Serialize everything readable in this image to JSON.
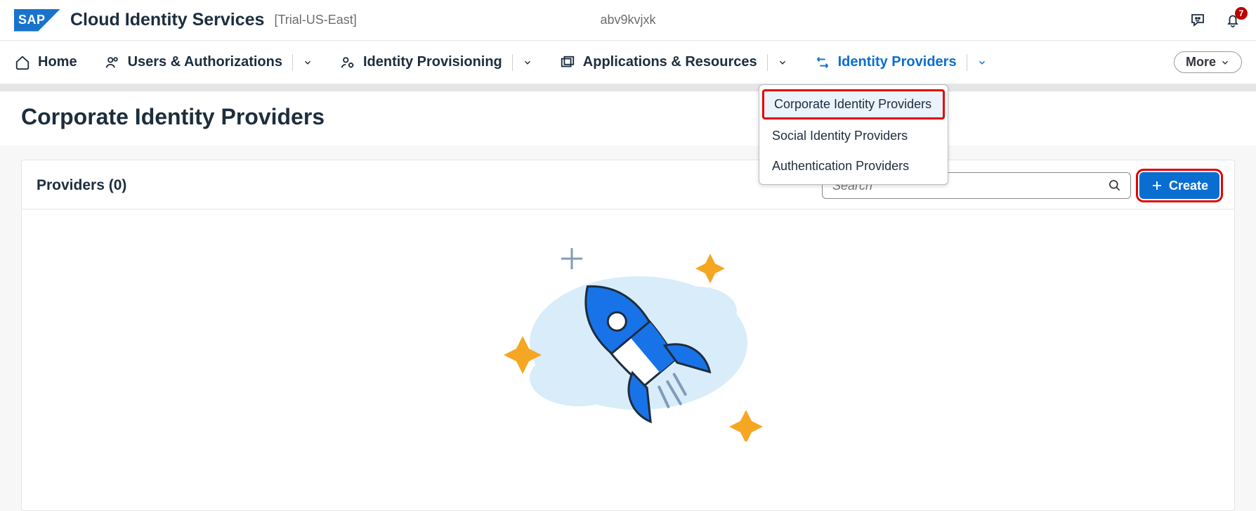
{
  "shell": {
    "app_title": "Cloud Identity Services",
    "subtitle": "[Trial-US-East]",
    "tenant_id": "abv9kvjxk",
    "notification_count": "7"
  },
  "nav": {
    "home": "Home",
    "users": "Users & Authorizations",
    "provisioning": "Identity Provisioning",
    "apps": "Applications & Resources",
    "idp": "Identity Providers",
    "more": "More"
  },
  "dropdown": {
    "corporate": "Corporate Identity Providers",
    "social": "Social Identity Providers",
    "auth": "Authentication Providers"
  },
  "page": {
    "title": "Corporate Identity Providers",
    "panel_title": "Providers (0)",
    "search_placeholder": "Search",
    "create_label": "Create"
  }
}
